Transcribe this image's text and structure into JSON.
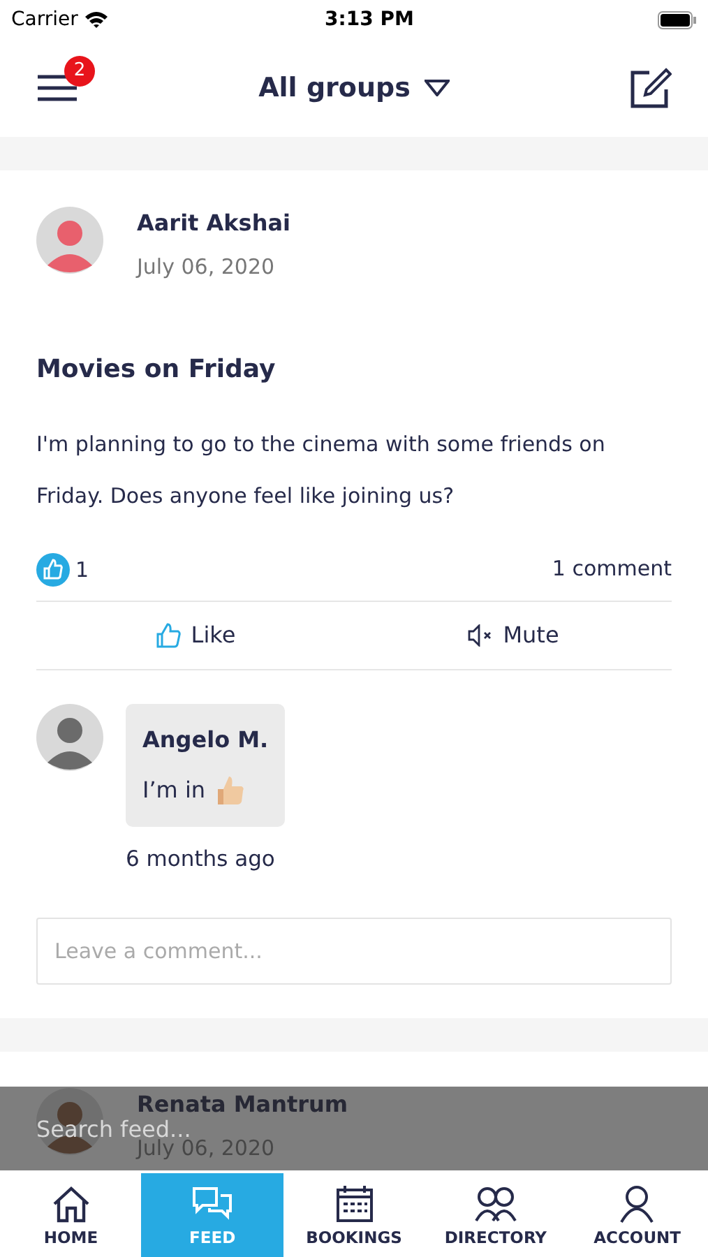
{
  "status_bar": {
    "carrier": "Carrier",
    "time": "3:13 PM"
  },
  "header": {
    "menu_badge": "2",
    "title": "All groups"
  },
  "posts": [
    {
      "author": "Aarit Akshai",
      "date": "July 06, 2020",
      "title": "Movies on Friday",
      "body": "I'm planning to go to the cinema with some friends on Friday. Does anyone feel like joining us?",
      "like_count": "1",
      "comment_count": "1 comment",
      "actions": [
        {
          "kind": "like",
          "label": "Like"
        },
        {
          "kind": "mute",
          "label": "Mute"
        }
      ],
      "comments": [
        {
          "author": "Angelo M.",
          "text": "I’m in",
          "time": "6 months ago"
        }
      ],
      "comment_field": {
        "placeholder": "Leave a comment..."
      }
    },
    {
      "author": "Renata Mantrum",
      "date": "July 06, 2020"
    }
  ],
  "search": {
    "placeholder": "Search feed..."
  },
  "tabs": [
    {
      "kind": "home",
      "label": "HOME",
      "selected": false
    },
    {
      "kind": "feed",
      "label": "FEED",
      "selected": true
    },
    {
      "kind": "bookings",
      "label": "BOOKINGS",
      "selected": false
    },
    {
      "kind": "directory",
      "label": "DIRECTORY",
      "selected": false
    },
    {
      "kind": "account",
      "label": "ACCOUNT",
      "selected": false
    }
  ]
}
